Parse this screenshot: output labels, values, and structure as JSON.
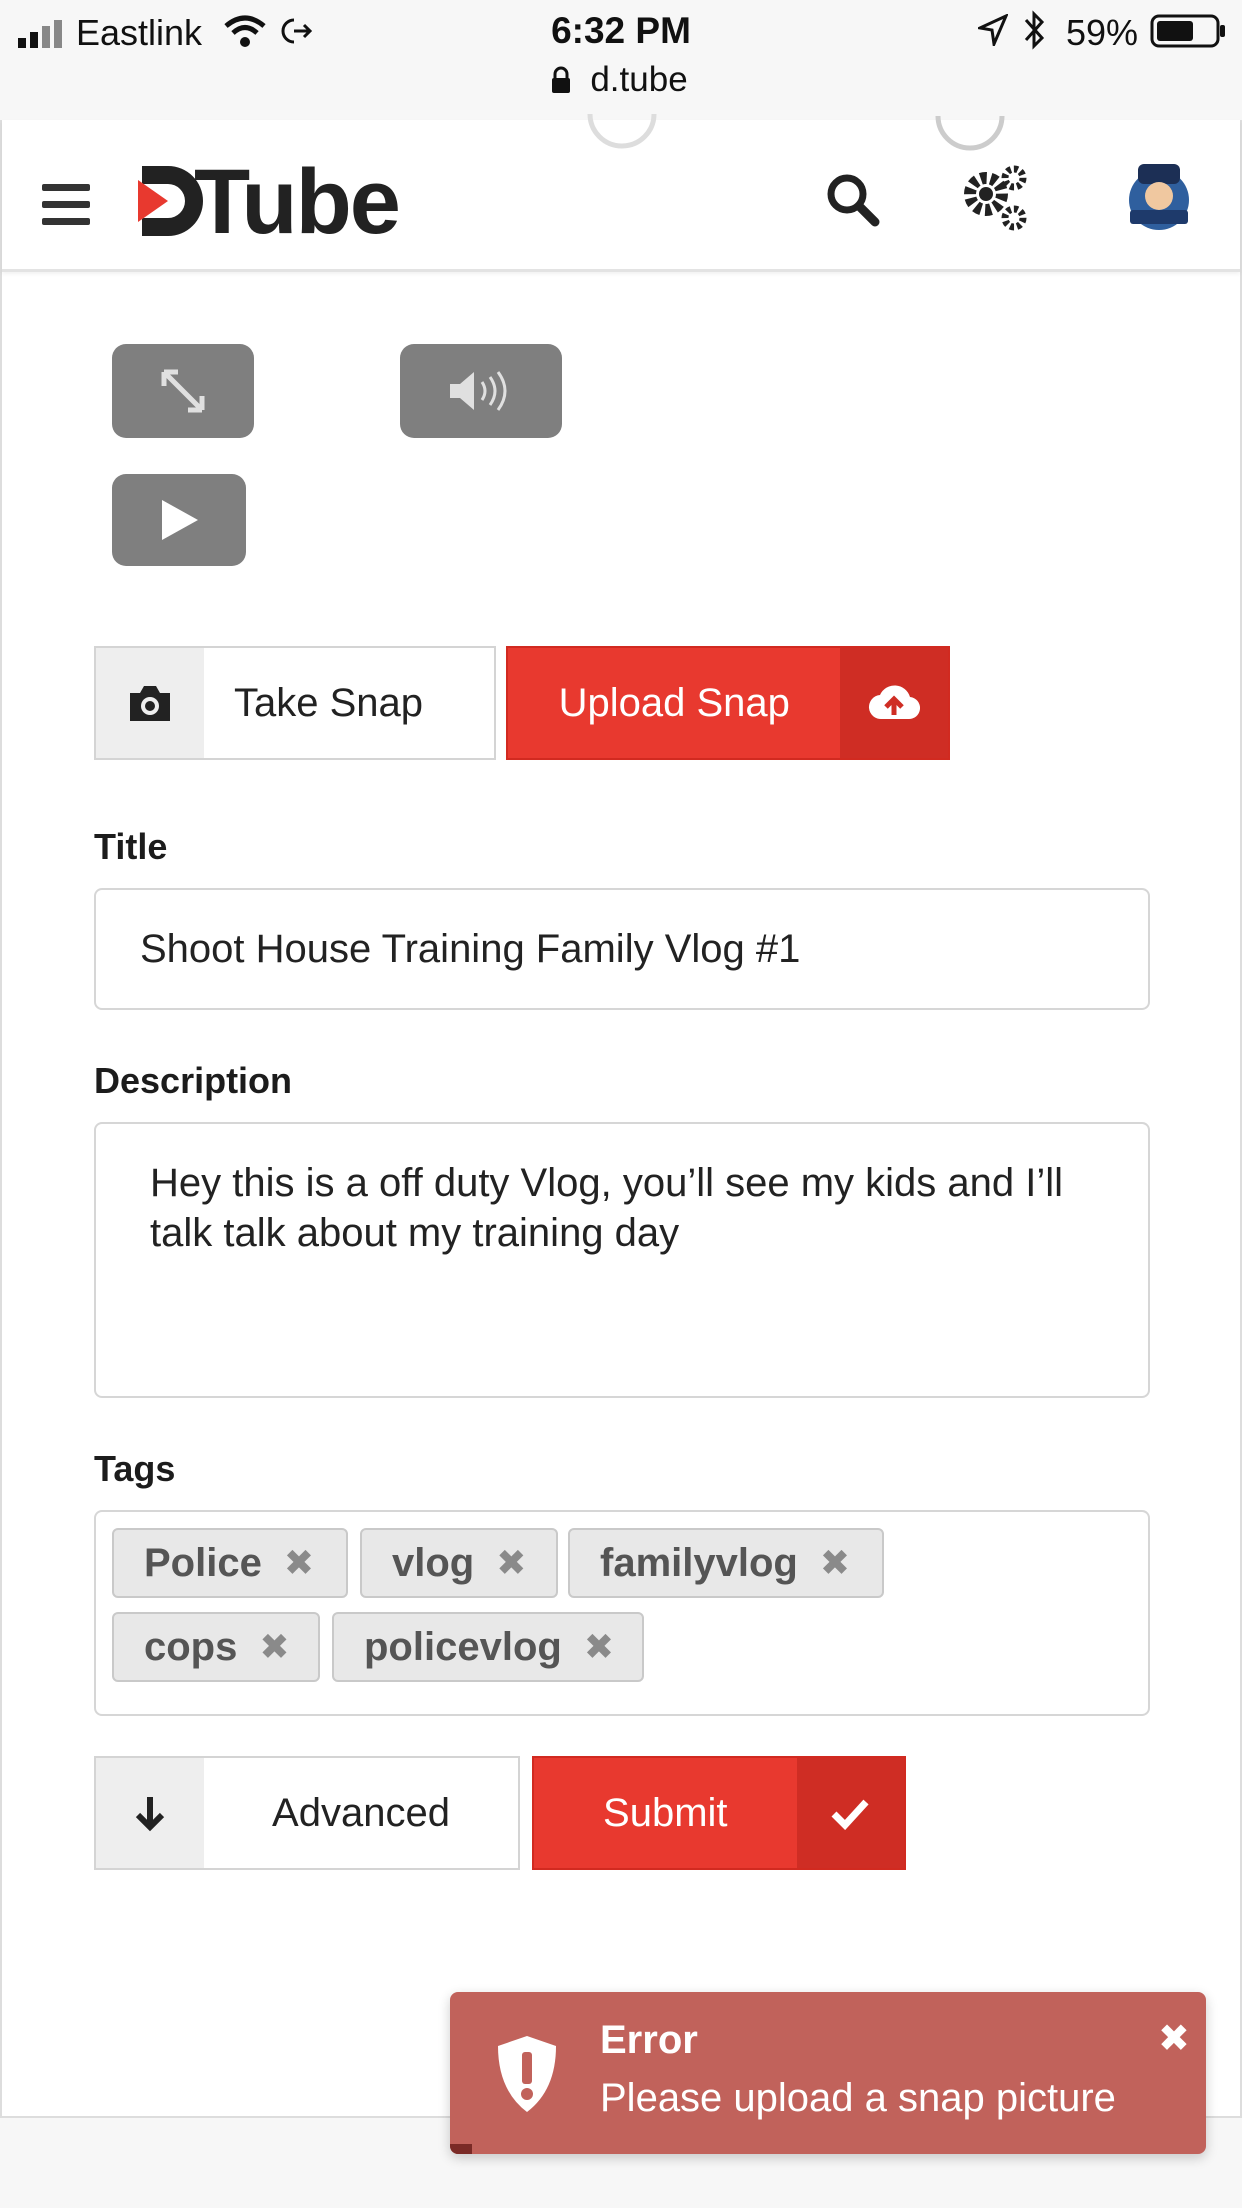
{
  "status_bar": {
    "carrier": "Eastlink",
    "time": "6:32 PM",
    "url": "d.tube",
    "battery": "59%"
  },
  "navbar": {
    "logo_text": "Tube",
    "icons": [
      "menu-icon",
      "search-icon",
      "gears-icon",
      "avatar"
    ]
  },
  "video_controls": [
    "fullscreen-icon",
    "volume-icon",
    "play-icon"
  ],
  "snap": {
    "take_label": "Take Snap",
    "upload_label": "Upload Snap"
  },
  "form": {
    "title_label": "Title",
    "title_value": "Shoot House Training Family Vlog #1",
    "description_label": "Description",
    "description_value": "Hey this is a off duty Vlog, you’ll see my kids and I’ll talk talk about my training day",
    "tags_label": "Tags",
    "tags": [
      "Police",
      "vlog",
      "familyvlog",
      "cops",
      "policevlog"
    ],
    "tag_remove": "✖"
  },
  "actions": {
    "advanced_label": "Advanced",
    "submit_label": "Submit"
  },
  "toast": {
    "title": "Error",
    "message": "Please upload a snap picture",
    "close": "✖"
  },
  "colors": {
    "accent": "#e8392f",
    "toast": "#c1625b"
  }
}
